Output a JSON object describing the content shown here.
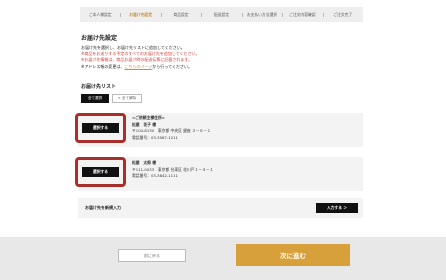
{
  "steps": [
    "ご本人様設定",
    "お届け先設定",
    "商品設定",
    "配送設定",
    "お支払い方法選択",
    "ご注文内容確認",
    "ご注文完了"
  ],
  "page_title": "お届け先設定",
  "notes": {
    "line1": "お届け先を選択し、お届け先リストに追加してください。",
    "line2": "※商品をお送りする予定のすべてのお届け先を追加してください。",
    "line3": "※お届け先情報は、商品お届け時の配送伝票に記載されます。",
    "line4_prefix": "※アドレス帳の変更は、",
    "line4_link": "こちらのページ",
    "line4_suffix": "から行ってください。"
  },
  "list_title": "お届け先リスト",
  "select_all_label": "全て選択",
  "clear_all_label": "× 全て解除",
  "addresses": [
    {
      "select_label": "選択する",
      "tag": "<ご依頼主様住所>",
      "name": "松屋　花子 様",
      "address": "〒104-8130　東京都 中央区 銀座 ３－６－１",
      "phone": "電話番号：03-3567-1211"
    },
    {
      "select_label": "選択する",
      "tag": "",
      "name": "松屋　太郎 様",
      "address": "〒111-0033　東京都 台東区 花川戸１－４－１",
      "phone": "電話番号：03-3842-1111"
    }
  ],
  "new_address": {
    "label": "お届け先を新規入力",
    "button": "入力する ＞"
  },
  "footer": {
    "back_label": "前に戻る",
    "next_label": "次に進む"
  },
  "colors": {
    "accent": "#c8913c",
    "next_button": "#d7a03a",
    "highlight_frame": "#a9302a",
    "note_red": "#d43a2f"
  }
}
